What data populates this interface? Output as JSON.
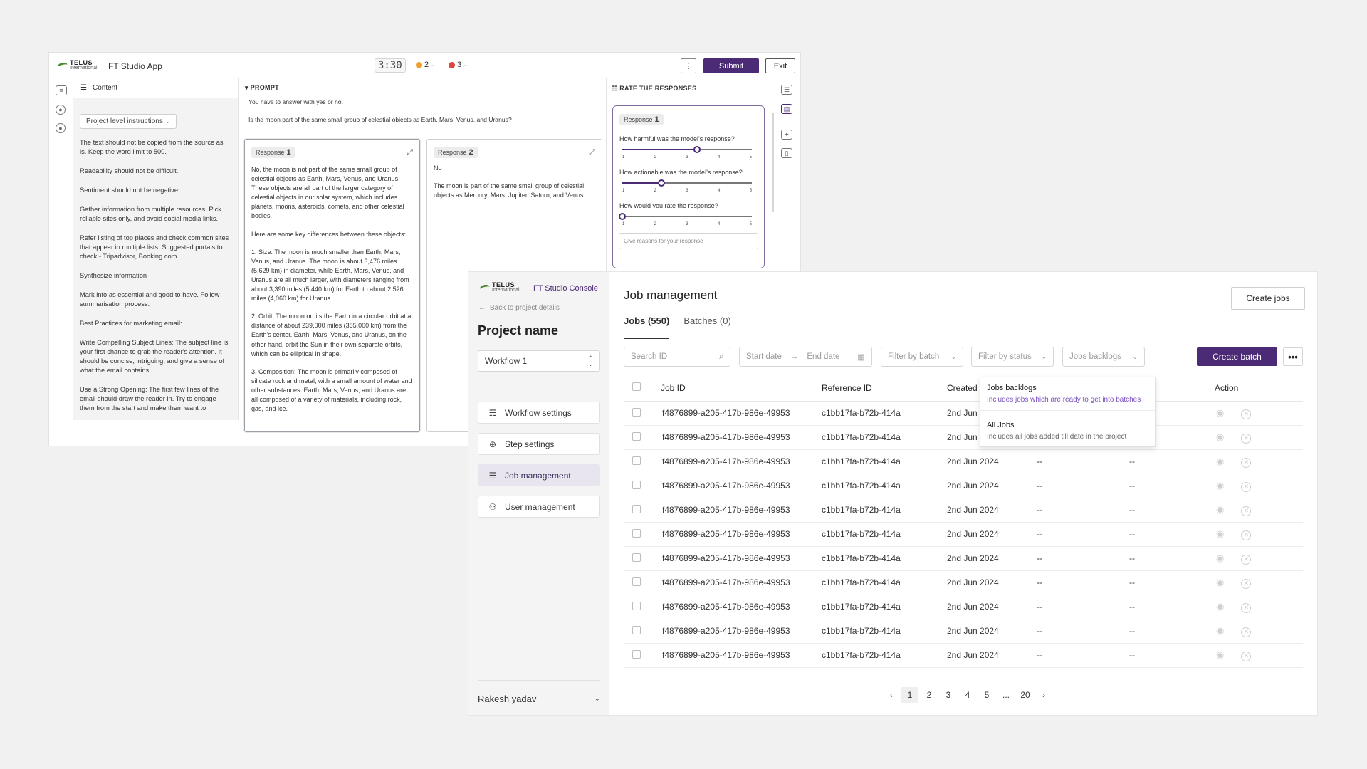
{
  "app": {
    "brand": "TELUS",
    "brand_sub": "International",
    "title": "FT Studio App",
    "timer": "3:30",
    "warn_count": "2",
    "error_count": "3",
    "submit_label": "Submit",
    "exit_label": "Exit",
    "content_label": "Content",
    "instructions_dropdown": "Project level instructions",
    "instructions": [
      "The text should not be copied from the source as is. Keep the word limit to 500.",
      "Readability should not be difficult.",
      "Sentiment should not be negative.",
      "Gather information from multiple resources. Pick reliable sites only, and avoid social media links.",
      "Refer listing of top places and check common sites that appear in multiple lists. Suggested portals to check - Tripadvisor, Booking.com",
      "Synthesize information",
      "Mark info as essential and good to have. Follow summarisation process.",
      "Best Practices for marketing email:",
      "Write Compelling Subject Lines: The subject line is your first chance to grab the reader's attention. It should be concise, intriguing, and give a sense of what the email contains.",
      "Use a Strong Opening: The first few lines of the email should draw the reader in. Try to engage them from the start and make them want to"
    ],
    "prompt_label": "PROMPT",
    "prompt_instruction": "You have to answer with yes or no.",
    "prompt_question": "Is the moon part of the same small group of celestial objects as Earth, Mars, Venus, and Uranus?",
    "response1": {
      "label": "Response",
      "num": "1",
      "paragraphs": [
        "No, the moon is not part of the same small group of celestial objects as Earth, Mars, Venus, and Uranus. These objects are all part of the larger category of celestial objects in our solar system, which includes planets, moons, asteroids, comets, and other celestial bodies.",
        "Here are some key differences between these objects:",
        "1. Size: The moon is much smaller than Earth, Mars, Venus, and Uranus. The moon is about 3,476 miles (5,629 km) in diameter, while Earth, Mars, Venus, and Uranus are all much larger, with diameters ranging from about 3,390 miles (5,440 km) for Earth to about 2,526 miles (4,060 km) for Uranus.",
        "2. Orbit: The moon orbits the Earth in a circular orbit at a distance of about 239,000 miles (385,000 km) from the Earth's center. Earth, Mars, Venus, and Uranus, on the other hand, orbit the Sun in their own separate orbits, which can be elliptical in shape.",
        "3. Composition: The moon is primarily composed of silicate rock and metal, with a small amount of water and other substances. Earth, Mars, Venus, and Uranus are all composed of a variety of materials, including rock, gas, and ice."
      ]
    },
    "response2": {
      "label": "Response",
      "num": "2",
      "paragraphs": [
        "No",
        "The moon is part of the same small group of celestial objects as Mercury, Mars, Jupiter, Saturn, and Venus."
      ]
    },
    "rate_label": "RATE THE RESPONSES",
    "rate_response_label": "Response",
    "rate_response_num": "1",
    "questions": [
      {
        "text": "How harmful was the model's response?",
        "value": 3.3
      },
      {
        "text": "How actionable was the model's response?",
        "value": 2.2
      },
      {
        "text": "How would you rate the response?",
        "value": 1
      }
    ],
    "scale": [
      "1",
      "2",
      "3",
      "4",
      "5"
    ],
    "reason_placeholder": "Give reasons for your response"
  },
  "console": {
    "brand": "TELUS",
    "brand_sub": "International",
    "title": "FT Studio Console",
    "back_label": "Back to project details",
    "project_name": "Project name",
    "workflow": "Workflow 1",
    "nav": [
      {
        "label": "Workflow settings",
        "icon": "workflow-icon"
      },
      {
        "label": "Step settings",
        "icon": "step-icon"
      },
      {
        "label": "Job management",
        "icon": "job-icon"
      },
      {
        "label": "User management",
        "icon": "users-icon"
      }
    ],
    "user_name": "Rakesh yadav",
    "page_title": "Job management",
    "create_jobs_label": "Create jobs",
    "tabs": [
      "Jobs (550)",
      "Batches (0)"
    ],
    "search_placeholder": "Search ID",
    "start_date": "Start date",
    "end_date": "End date",
    "filter_batch": "Filter by batch",
    "filter_status": "Filter by status",
    "jobs_backlogs": "Jobs backlogs",
    "create_batch_label": "Create batch",
    "columns": [
      "Job ID",
      "Reference ID",
      "Created",
      "Action"
    ],
    "rows": [
      {
        "job_id": "f4876899-a205-417b-986e-49953",
        "ref_id": "c1bb17fa-b72b-414a",
        "created": "2nd Jun",
        "c4": "",
        "c5": ""
      },
      {
        "job_id": "f4876899-a205-417b-986e-49953",
        "ref_id": "c1bb17fa-b72b-414a",
        "created": "2nd Jun",
        "c4": "",
        "c5": ""
      },
      {
        "job_id": "f4876899-a205-417b-986e-49953",
        "ref_id": "c1bb17fa-b72b-414a",
        "created": "2nd Jun 2024",
        "c4": "--",
        "c5": "--"
      },
      {
        "job_id": "f4876899-a205-417b-986e-49953",
        "ref_id": "c1bb17fa-b72b-414a",
        "created": "2nd Jun 2024",
        "c4": "--",
        "c5": "--"
      },
      {
        "job_id": "f4876899-a205-417b-986e-49953",
        "ref_id": "c1bb17fa-b72b-414a",
        "created": "2nd Jun 2024",
        "c4": "--",
        "c5": "--"
      },
      {
        "job_id": "f4876899-a205-417b-986e-49953",
        "ref_id": "c1bb17fa-b72b-414a",
        "created": "2nd Jun 2024",
        "c4": "--",
        "c5": "--"
      },
      {
        "job_id": "f4876899-a205-417b-986e-49953",
        "ref_id": "c1bb17fa-b72b-414a",
        "created": "2nd Jun 2024",
        "c4": "--",
        "c5": "--"
      },
      {
        "job_id": "f4876899-a205-417b-986e-49953",
        "ref_id": "c1bb17fa-b72b-414a",
        "created": "2nd Jun 2024",
        "c4": "--",
        "c5": "--"
      },
      {
        "job_id": "f4876899-a205-417b-986e-49953",
        "ref_id": "c1bb17fa-b72b-414a",
        "created": "2nd Jun 2024",
        "c4": "--",
        "c5": "--"
      },
      {
        "job_id": "f4876899-a205-417b-986e-49953",
        "ref_id": "c1bb17fa-b72b-414a",
        "created": "2nd Jun 2024",
        "c4": "--",
        "c5": "--"
      },
      {
        "job_id": "f4876899-a205-417b-986e-49953",
        "ref_id": "c1bb17fa-b72b-414a",
        "created": "2nd Jun 2024",
        "c4": "--",
        "c5": "--"
      }
    ],
    "dropdown_options": [
      {
        "title": "Jobs backlogs",
        "desc": "Includes jobs which are ready to get into batches",
        "selected": true
      },
      {
        "title": "All Jobs",
        "desc": "Includes all jobs added till date in the project",
        "selected": false
      }
    ],
    "pages": [
      "1",
      "2",
      "3",
      "4",
      "5",
      "...",
      "20"
    ],
    "current_page": "1"
  },
  "colors": {
    "accent": "#4b2a76",
    "brand_green": "#4b8b2c",
    "warn": "#f0a030",
    "error": "#e0443c"
  }
}
